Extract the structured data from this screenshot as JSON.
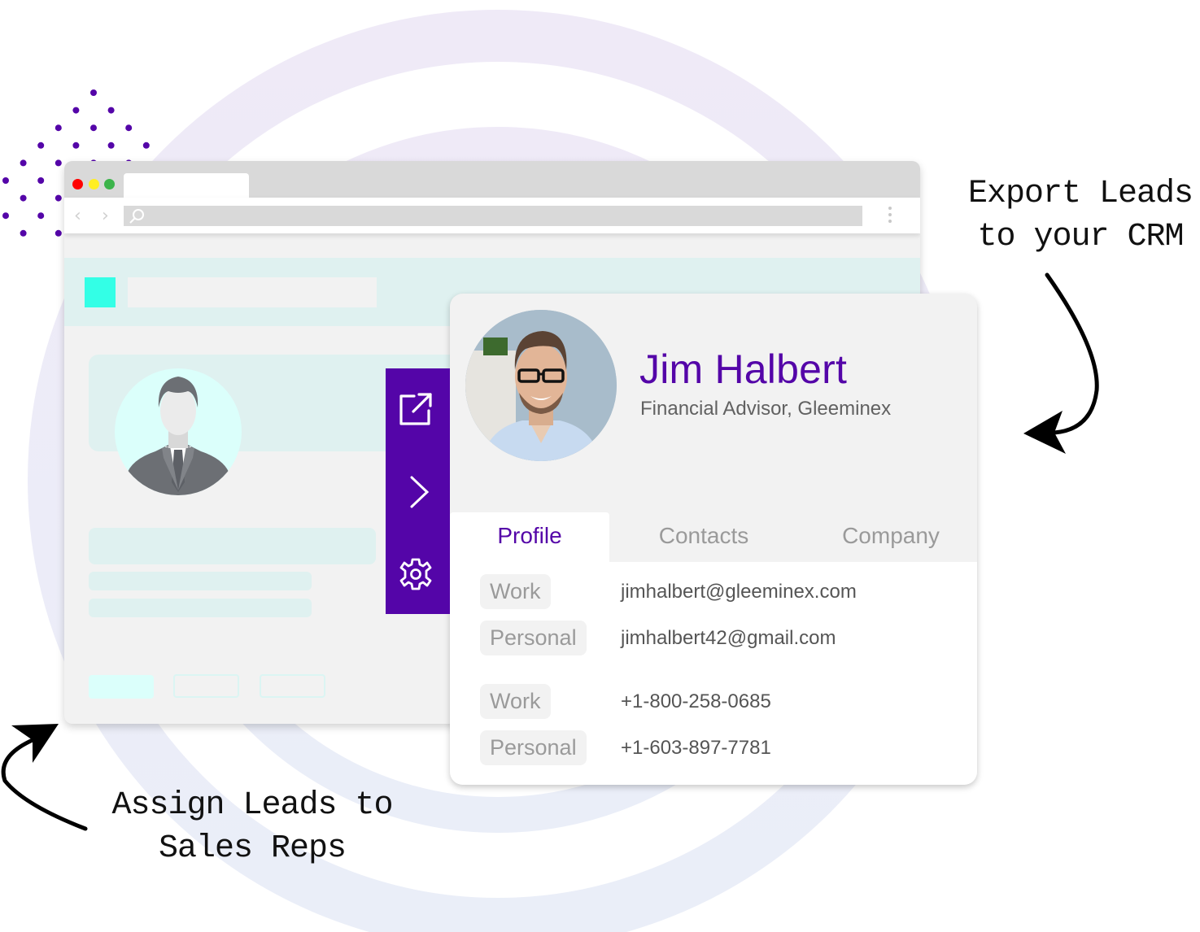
{
  "colors": {
    "brand_purple": "#5405a8",
    "accent_teal": "#33ffe6",
    "skeleton_teal": "#dff1f0",
    "ring": "#ecebf7"
  },
  "browser": {
    "traffic_lights": [
      "close",
      "minimize",
      "maximize"
    ],
    "nav_back_glyph": "‹",
    "nav_forward_glyph": "›",
    "address_bar_icon": "search-icon",
    "menu_icon": "kebab-menu-icon"
  },
  "action_rail": {
    "items": [
      {
        "icon": "external-link-icon",
        "label": "Export"
      },
      {
        "icon": "chevron-right-icon",
        "label": "Expand"
      },
      {
        "icon": "gear-icon",
        "label": "Settings"
      }
    ]
  },
  "profile": {
    "name": "Jim Halbert",
    "title": "Financial Advisor, Gleeminex",
    "avatar": "profile-photo"
  },
  "tabs": [
    {
      "label": "Profile",
      "active": true
    },
    {
      "label": "Contacts",
      "active": false
    },
    {
      "label": "Company",
      "active": false
    }
  ],
  "contacts": {
    "emails": [
      {
        "type": "Work",
        "value": "jimhalbert@gleeminex.com"
      },
      {
        "type": "Personal",
        "value": "jimhalbert42@gmail.com"
      }
    ],
    "phones": [
      {
        "type": "Work",
        "value": "+1-800-258-0685"
      },
      {
        "type": "Personal",
        "value": "+1-603-897-7781"
      }
    ]
  },
  "annotations": {
    "export": {
      "line1": "Export Leads",
      "line2": "to your CRM"
    },
    "assign": {
      "line1": "Assign Leads to",
      "line2": "Sales Reps"
    }
  }
}
